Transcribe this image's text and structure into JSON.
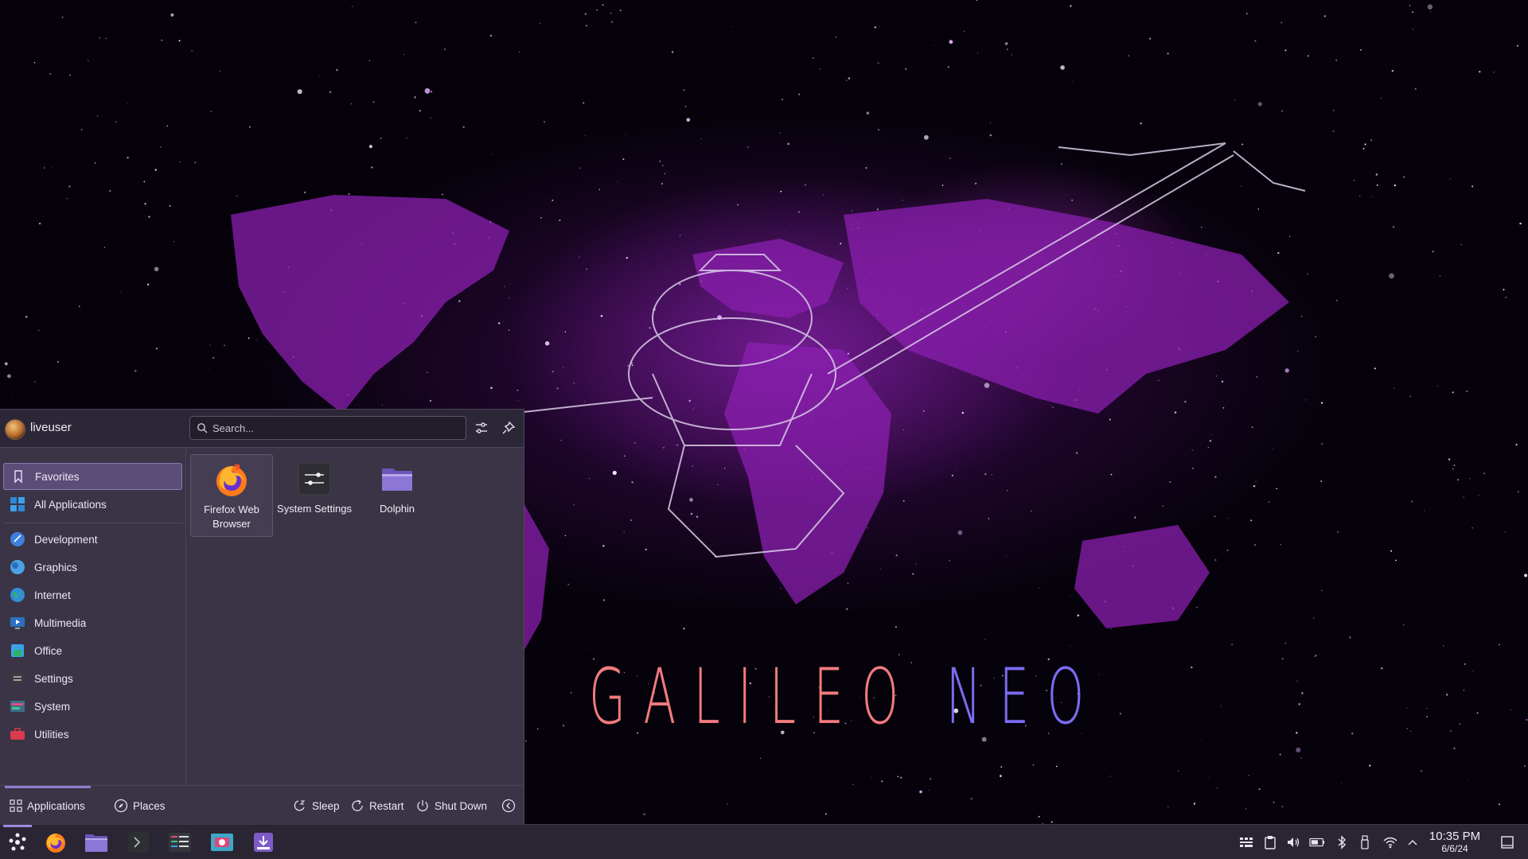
{
  "wallpaper": {
    "title_word1": "GALILEO",
    "title_word2": "NEO",
    "title_colors": {
      "word1": "#f27a7e",
      "word2": "#7a6cf0"
    }
  },
  "launcher": {
    "username": "liveuser",
    "search": {
      "placeholder": "Search...",
      "value": ""
    },
    "header_icons": [
      "configure-icon",
      "pin-icon"
    ],
    "sidebar": {
      "items": [
        {
          "label": "Favorites",
          "icon": "bookmark-icon",
          "active": true
        },
        {
          "label": "All Applications",
          "icon": "all-apps-icon"
        },
        {
          "label": "Development",
          "icon": "development-icon"
        },
        {
          "label": "Graphics",
          "icon": "graphics-icon"
        },
        {
          "label": "Internet",
          "icon": "internet-icon"
        },
        {
          "label": "Multimedia",
          "icon": "multimedia-icon"
        },
        {
          "label": "Office",
          "icon": "office-icon"
        },
        {
          "label": "Settings",
          "icon": "settings-icon"
        },
        {
          "label": "System",
          "icon": "system-icon"
        },
        {
          "label": "Utilities",
          "icon": "utilities-icon"
        }
      ]
    },
    "favorites": [
      {
        "label": "Firefox Web Browser",
        "icon": "firefox-icon"
      },
      {
        "label": "System Settings",
        "icon": "system-settings-icon"
      },
      {
        "label": "Dolphin",
        "icon": "dolphin-folder-icon"
      }
    ],
    "footer": {
      "tabs": [
        {
          "label": "Applications",
          "icon": "applications-grid-icon",
          "active": true
        },
        {
          "label": "Places",
          "icon": "places-compass-icon"
        }
      ],
      "power": [
        {
          "label": "Sleep",
          "icon": "sleep-icon"
        },
        {
          "label": "Restart",
          "icon": "restart-icon"
        },
        {
          "label": "Shut Down",
          "icon": "shutdown-icon"
        }
      ],
      "more_icon": "leave-options-icon"
    }
  },
  "taskbar": {
    "launchers": [
      "app-launcher-icon",
      "firefox-icon",
      "dolphin-icon",
      "konsole-icon",
      "system-monitor-icon",
      "screenshot-icon",
      "installer-icon"
    ],
    "tray": [
      "keyboard-layout-icon",
      "clipboard-icon",
      "volume-icon",
      "battery-icon",
      "bluetooth-icon",
      "usb-device-icon",
      "wifi-icon",
      "expand-tray-icon"
    ],
    "clock": {
      "time": "10:35 PM",
      "date": "6/6/24"
    },
    "show_desktop_icon": "peek-desktop-icon"
  },
  "colors": {
    "panel_bg": "#2a2532",
    "launcher_bg": "#3a3446",
    "accent": "#8e7fd0",
    "selection": "#5b4d78"
  }
}
